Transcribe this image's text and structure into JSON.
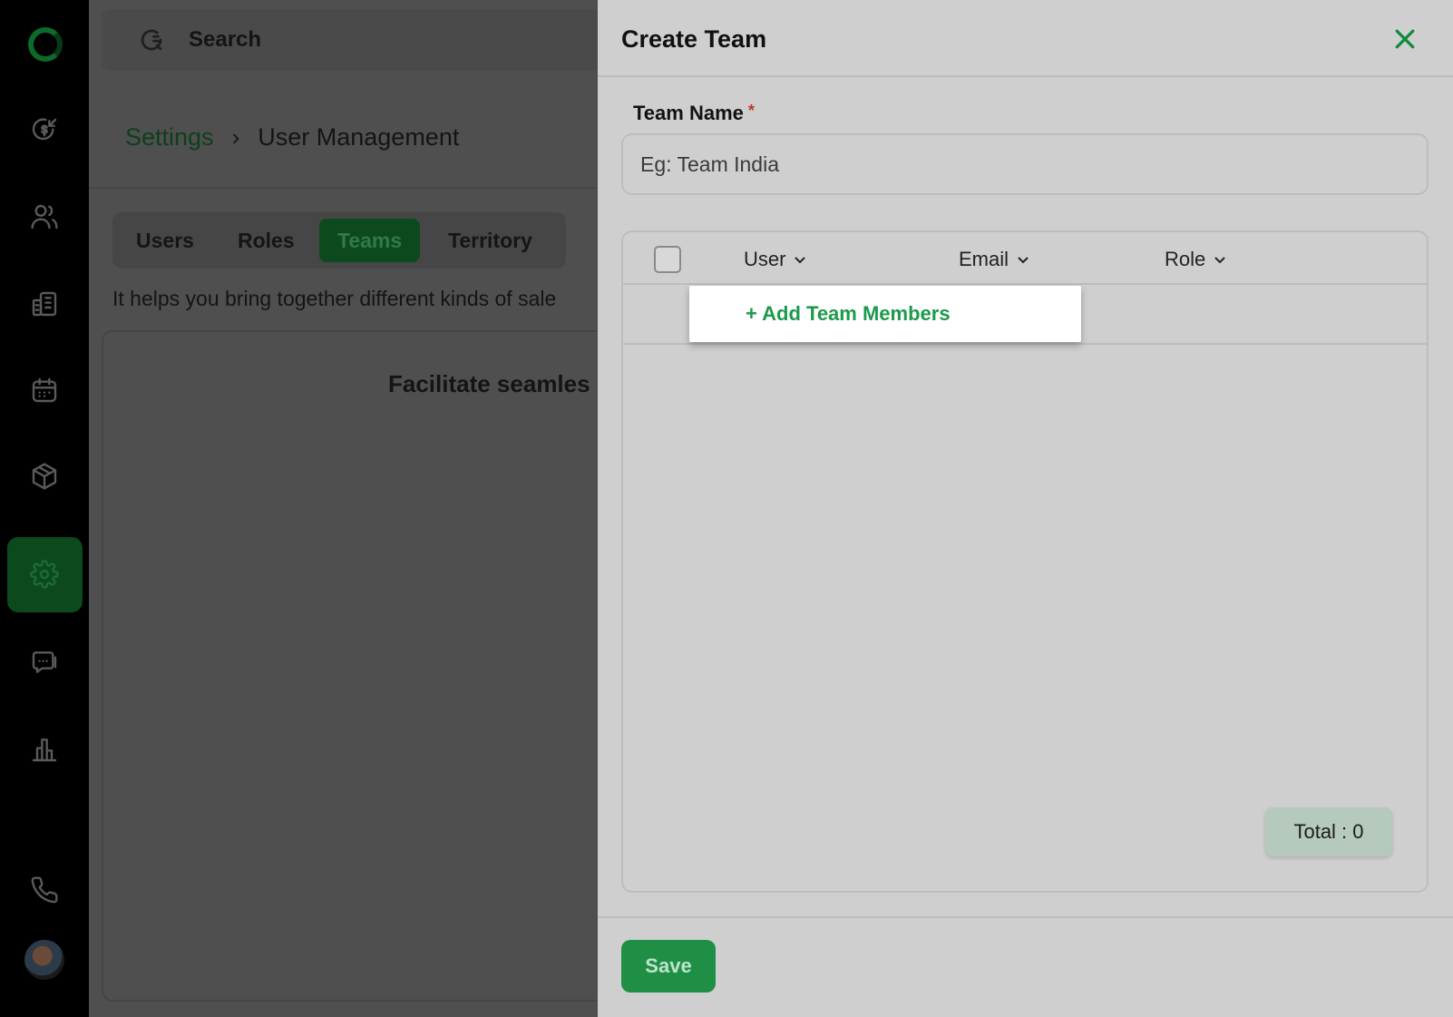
{
  "search": {
    "label": "Search"
  },
  "breadcrumb": {
    "parent": "Settings",
    "current": "User Management"
  },
  "tabs": [
    {
      "label": "Users",
      "active": false
    },
    {
      "label": "Roles",
      "active": false
    },
    {
      "label": "Teams",
      "active": true
    },
    {
      "label": "Territory",
      "active": false
    }
  ],
  "help_text": "It helps you bring together different kinds of sale",
  "card": {
    "heading": "Facilitate seamles"
  },
  "sidebar": {
    "icons": [
      "revenue-icon",
      "contacts-icon",
      "accounts-icon",
      "calendar-icon",
      "products-icon",
      "settings-icon",
      "chat-icon",
      "reports-icon",
      "phone-icon"
    ],
    "active": "settings-icon"
  },
  "drawer": {
    "title": "Create Team",
    "team_name_label": "Team Name",
    "required_mark": "*",
    "team_name_placeholder": "Eg: Team India",
    "columns": {
      "user": "User",
      "email": "Email",
      "role": "Role"
    },
    "add_members": "+ Add Team Members",
    "total": "Total : 0",
    "save": "Save"
  },
  "colors": {
    "accent": "#1e8f45",
    "overlay": "#4f4f4f",
    "drawer_bg": "#cfcfcf"
  }
}
